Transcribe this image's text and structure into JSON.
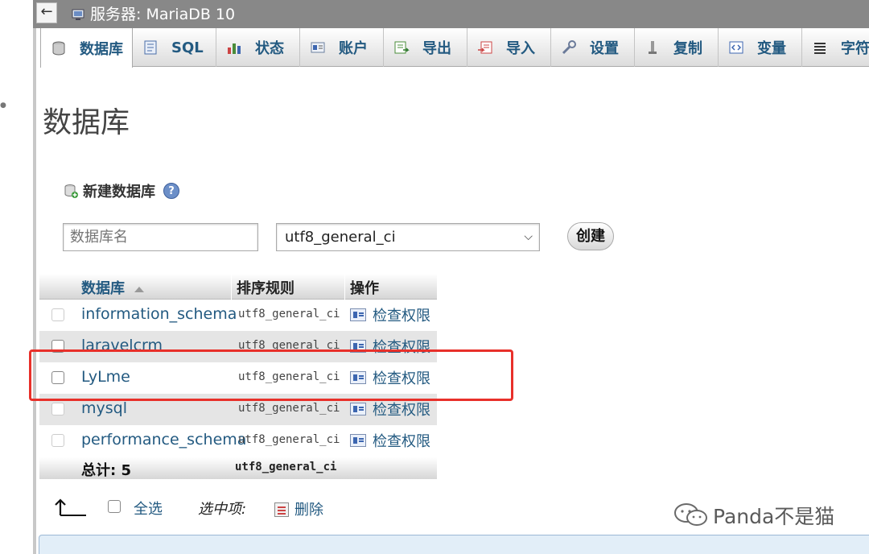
{
  "window": {
    "back_label": "←",
    "server_title": "服务器: MariaDB 10"
  },
  "tabs": [
    {
      "label": "数据库",
      "icon": "database-icon"
    },
    {
      "label": "SQL",
      "icon": "sql-icon"
    },
    {
      "label": "状态",
      "icon": "status-icon"
    },
    {
      "label": "账户",
      "icon": "accounts-icon"
    },
    {
      "label": "导出",
      "icon": "export-icon"
    },
    {
      "label": "导入",
      "icon": "import-icon"
    },
    {
      "label": "设置",
      "icon": "settings-wrench-icon"
    },
    {
      "label": "复制",
      "icon": "replication-icon"
    },
    {
      "label": "变量",
      "icon": "variables-icon"
    },
    {
      "label": "字符",
      "icon": "charsets-icon"
    }
  ],
  "page": {
    "title": "数据库"
  },
  "create_db": {
    "heading": "新建数据库",
    "help": "?",
    "name_placeholder": "数据库名",
    "collation_value": "utf8_general_ci",
    "create_label": "创建"
  },
  "table": {
    "headers": {
      "database": "数据库",
      "collation": "排序规则",
      "action": "操作"
    },
    "rows": [
      {
        "name": "information_schema",
        "collation": "utf8_general_ci",
        "action": "检查权限"
      },
      {
        "name": "laravelcrm",
        "collation": "utf8_general_ci",
        "action": "检查权限"
      },
      {
        "name": "LyLme",
        "collation": "utf8_general_ci",
        "action": "检查权限"
      },
      {
        "name": "mysql",
        "collation": "utf8_general_ci",
        "action": "检查权限"
      },
      {
        "name": "performance_schema",
        "collation": "utf8_general_ci",
        "action": "检查权限"
      }
    ],
    "total_label": "总计: 5",
    "total_collation": "utf8_general_ci"
  },
  "bulk": {
    "select_all": "全选",
    "with_selected": "选中项:",
    "delete": "删除"
  },
  "watermark": "Panda不是猫",
  "colors": {
    "link": "#235a81",
    "topbar": "#888888",
    "highlight": "#e8302a"
  }
}
